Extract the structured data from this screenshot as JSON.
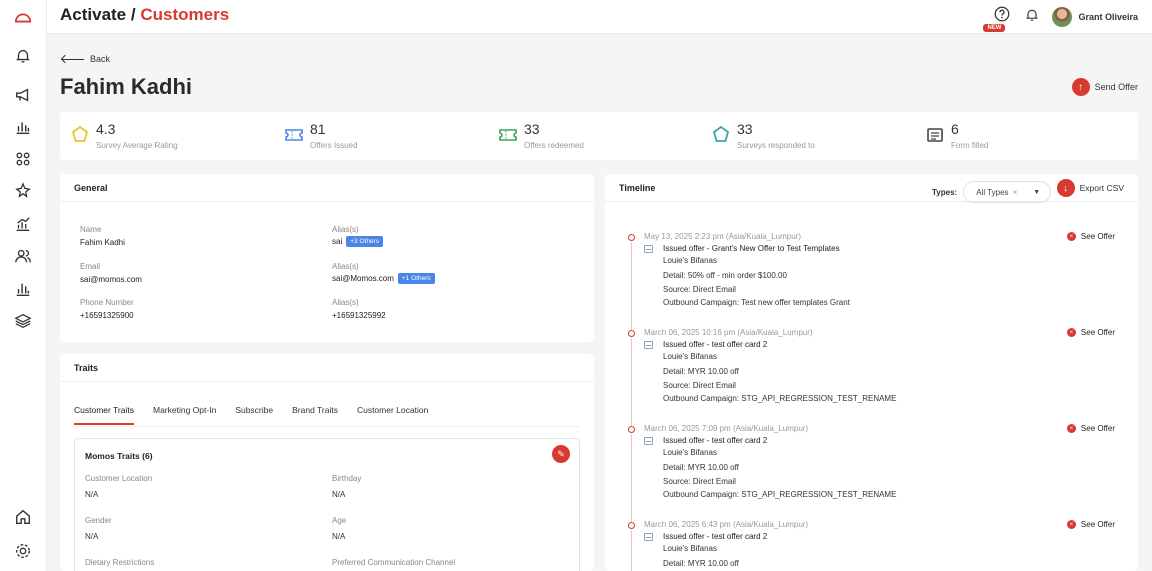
{
  "breadcrumb": {
    "section": "Activate",
    "separator": "/",
    "current": "Customers"
  },
  "header": {
    "help_badge": "NEW",
    "user_name": "Grant Oliveira"
  },
  "nav": {
    "back_label": "Back",
    "icons": [
      "logo-icon",
      "bell-icon",
      "megaphone-icon",
      "bar-chart-icon",
      "grid-icon",
      "sparkle-icon",
      "analytics-icon",
      "users-icon",
      "stats-icon",
      "layers-icon",
      "home-icon",
      "settings-icon"
    ]
  },
  "customer": {
    "name": "Fahim Kadhi"
  },
  "actions": {
    "send_offer": "Send Offer",
    "export_csv": "Export CSV"
  },
  "stats": [
    {
      "value": "4.3",
      "label": "Survey Average Rating",
      "icon": "star-icon",
      "color": "#f2c230"
    },
    {
      "value": "81",
      "label": "Offers Issued",
      "icon": "ticket-icon",
      "color": "#4a86e8"
    },
    {
      "value": "33",
      "label": "Offers redeemed",
      "icon": "ticket-redeemed-icon",
      "color": "#3aa45a"
    },
    {
      "value": "33",
      "label": "Surveys responded to",
      "icon": "pentagon-icon",
      "color": "#3aa8a0"
    },
    {
      "value": "6",
      "label": "Form filled",
      "icon": "form-icon",
      "color": "#444444"
    }
  ],
  "general": {
    "title": "General",
    "fields": [
      {
        "label": "Name",
        "value": "Fahim Kadhi"
      },
      {
        "label": "Alias(s)",
        "value": "sai",
        "extra": "+3 Others"
      },
      {
        "label": "Email",
        "value": "sai@momos.com"
      },
      {
        "label": "Alias(s)",
        "value": "sai@Momos.com",
        "extra": "+1 Others"
      },
      {
        "label": "Phone Number",
        "value": "+16591325900"
      },
      {
        "label": "Alias(s)",
        "value": "+16591325992"
      }
    ]
  },
  "traits": {
    "title": "Traits",
    "tabs": [
      "Customer Traits",
      "Marketing Opt-In",
      "Subscribe",
      "Brand Traits",
      "Customer Location"
    ],
    "group_title": "Momos Traits (6)",
    "items": [
      {
        "label": "Customer Location",
        "value": "N/A"
      },
      {
        "label": "Birthday",
        "value": "N/A"
      },
      {
        "label": "Gender",
        "value": "N/A"
      },
      {
        "label": "Age",
        "value": "N/A"
      },
      {
        "label": "Dietary Restrictions",
        "value": ""
      },
      {
        "label": "Preferred Communication Channel",
        "value": ""
      }
    ]
  },
  "timeline": {
    "title": "Timeline",
    "types_label": "Types:",
    "types_value": "All Types",
    "types_clear": "×",
    "see_offer": "See Offer",
    "entries": [
      {
        "date": "May 13, 2025 2:23 pm (Asia/Kuala_Lumpur)",
        "title": "Issued offer - Grant's New Offer to Test Templates",
        "store": "Louie's Bifanas",
        "details": [
          "Detail: 50% off - min order $100.00",
          "Source: Direct Email",
          "Outbound Campaign: Test new offer templates Grant"
        ]
      },
      {
        "date": "March 06, 2025 10:16 pm (Asia/Kuala_Lumpur)",
        "title": "Issued offer - test offer card 2",
        "store": "Louie's Bifanas",
        "details": [
          "Detail: MYR 10.00 off",
          "Source: Direct Email",
          "Outbound Campaign: STG_API_REGRESSION_TEST_RENAME"
        ]
      },
      {
        "date": "March 06, 2025 7:09 pm (Asia/Kuala_Lumpur)",
        "title": "Issued offer - test offer card 2",
        "store": "Louie's Bifanas",
        "details": [
          "Detail: MYR 10.00 off",
          "Source: Direct Email",
          "Outbound Campaign: STG_API_REGRESSION_TEST_RENAME"
        ]
      },
      {
        "date": "March 06, 2025 6:43 pm (Asia/Kuala_Lumpur)",
        "title": "Issued offer - test offer card 2",
        "store": "Louie's Bifanas",
        "details": [
          "Detail: MYR 10.00 off"
        ]
      }
    ]
  }
}
